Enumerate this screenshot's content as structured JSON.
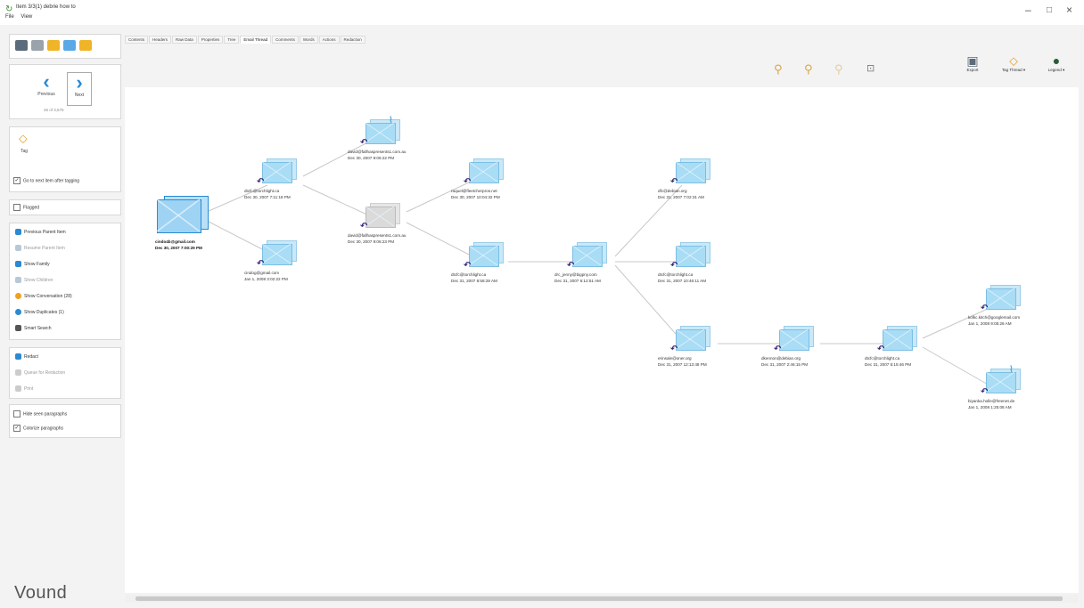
{
  "window": {
    "title": "Item 3/3(1) debrie how to",
    "menu": [
      "File",
      "View"
    ],
    "controls": {
      "minimize": "–",
      "maximize": "□",
      "close": "×"
    }
  },
  "sidebar": {
    "nav": {
      "previous": "Previous",
      "next": "Next",
      "count": "46 of 3,675"
    },
    "tag": {
      "label": "Tag"
    },
    "go_next_after_tag": "Go to next item after tagging",
    "flagged": "Flagged",
    "actions": [
      {
        "label": "Previous Parent Item",
        "disabled": false
      },
      {
        "label": "Resume Parent Item",
        "disabled": true
      },
      {
        "label": "Show Family",
        "disabled": false
      },
      {
        "label": "Show Children",
        "disabled": true
      },
      {
        "label": "Show Conversation (28)",
        "disabled": false
      },
      {
        "label": "Show Duplicates (1)",
        "disabled": false
      },
      {
        "label": "Smart Search",
        "disabled": false
      }
    ],
    "redact": [
      {
        "label": "Redact",
        "disabled": false
      },
      {
        "label": "Queue for Redaction",
        "disabled": true
      },
      {
        "label": "Print",
        "disabled": true
      }
    ],
    "paragraphs": [
      {
        "label": "Hide seen paragraphs",
        "checked": false
      },
      {
        "label": "Colorize paragraphs",
        "checked": true
      }
    ],
    "logo": "Vound"
  },
  "tabs": [
    "Contents",
    "Headers",
    "Raw Data",
    "Properties",
    "Tree",
    "Email Thread",
    "Comments",
    "Words",
    "Actions",
    "Redaction"
  ],
  "active_tab": "Email Thread",
  "toolbar": {
    "export": "Export",
    "tag_thread": "Tag Thread ▾",
    "legend": "Legend ▾"
  },
  "nodes": [
    {
      "id": "root",
      "email": "cindo4b@gmail.com",
      "date": "Dec 30, 2007 7:00:29 PM"
    },
    {
      "id": "n1",
      "email": "dtcfc@torchlight.ca",
      "date": "Dec 30, 2007 7:11:18 PM"
    },
    {
      "id": "n2",
      "email": "cindog@gmail.com",
      "date": "Jan 1, 2008 3:02:22 PM"
    },
    {
      "id": "n3",
      "email": "david@fallhaspresents1.com.au",
      "date": "Dec 30, 2007 9:06:22 PM"
    },
    {
      "id": "n4",
      "email": "david@fallhaspresents1.com.au",
      "date": "Dec 30, 2007 9:06:23 PM"
    },
    {
      "id": "n5",
      "email": "raquel@fleetcherpros.net",
      "date": "Dec 30, 2007 10:04:32 PM"
    },
    {
      "id": "n6",
      "email": "dtcfc@torchlight.ca",
      "date": "Dec 31, 2007 8:58:28 AM"
    },
    {
      "id": "n7",
      "email": "drc_jenny@bigpny.com",
      "date": "Dec 31, 2007 6:12:51 AM"
    },
    {
      "id": "n8",
      "email": "dfc@debian.org",
      "date": "Dec 31, 2007 7:02:31 AM"
    },
    {
      "id": "n9",
      "email": "dtcfc@torchlight.ca",
      "date": "Dec 31, 2007 10:46:11 AM"
    },
    {
      "id": "n10",
      "email": "erinsale@oner.org",
      "date": "Dec 31, 2007 12:13:48 PM"
    },
    {
      "id": "n11",
      "email": "dkennon@debian.org",
      "date": "Dec 31, 2007 2:46:15 PM"
    },
    {
      "id": "n12",
      "email": "dtcfc@torchlight.ca",
      "date": "Dec 31, 2007 6:15:46 PM"
    },
    {
      "id": "n13",
      "email": "kolkc.kitch@googlemail.com",
      "date": "Jan 1, 2008 9:05:26 AM"
    },
    {
      "id": "n14",
      "email": "biyanka.holle@freenet.de",
      "date": "Jan 1, 2008 1:25:08 AM"
    }
  ]
}
